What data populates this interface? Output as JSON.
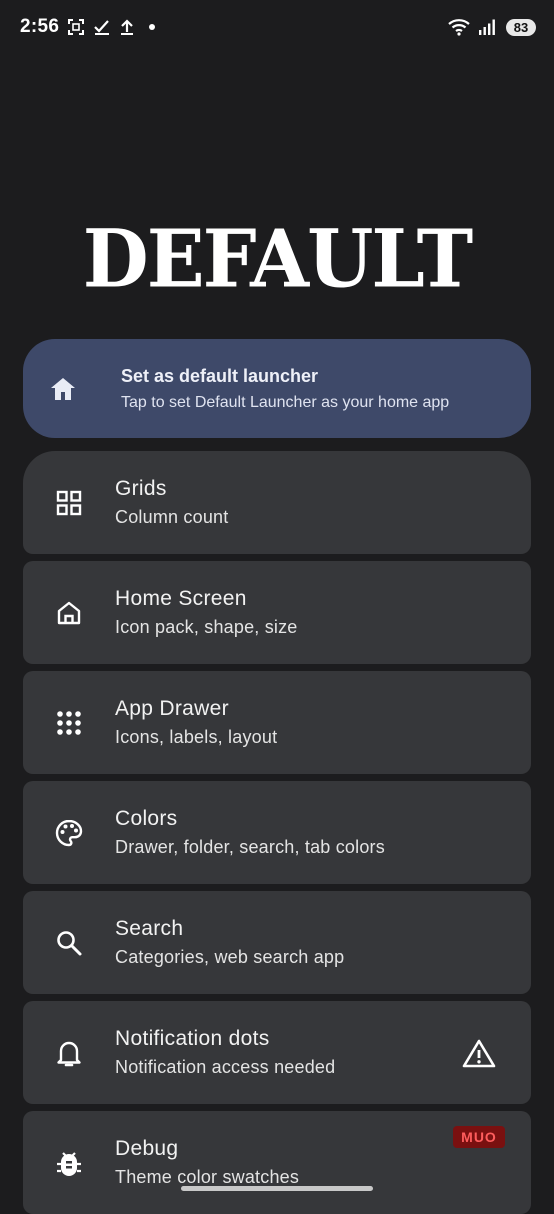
{
  "status_bar": {
    "time": "2:56",
    "icons": [
      "screenshot-icon",
      "check-icon",
      "upload-icon",
      "dot-icon"
    ],
    "right_icons": [
      "wifi-icon",
      "signal-icon"
    ],
    "battery": "83"
  },
  "logo": {
    "text": "DEFAULT"
  },
  "banner": {
    "icon": "home-icon",
    "title": "Set as default launcher",
    "subtitle": "Tap to set Default Launcher as your home app"
  },
  "settings": [
    {
      "icon": "grid-icon",
      "title": "Grids",
      "subtitle": "Column count"
    },
    {
      "icon": "home-screen-icon",
      "title": "Home Screen",
      "subtitle": "Icon pack, shape, size"
    },
    {
      "icon": "app-drawer-icon",
      "title": "App Drawer",
      "subtitle": "Icons, labels, layout"
    },
    {
      "icon": "palette-icon",
      "title": "Colors",
      "subtitle": "Drawer, folder, search, tab colors"
    },
    {
      "icon": "search-icon",
      "title": "Search",
      "subtitle": "Categories, web search app"
    },
    {
      "icon": "notification-bell-icon",
      "title": "Notification dots",
      "subtitle": "Notification access needed",
      "trailing": "warning-icon"
    },
    {
      "icon": "debug-icon",
      "title": "Debug",
      "subtitle": "Theme color swatches"
    }
  ],
  "watermark": "MUO"
}
